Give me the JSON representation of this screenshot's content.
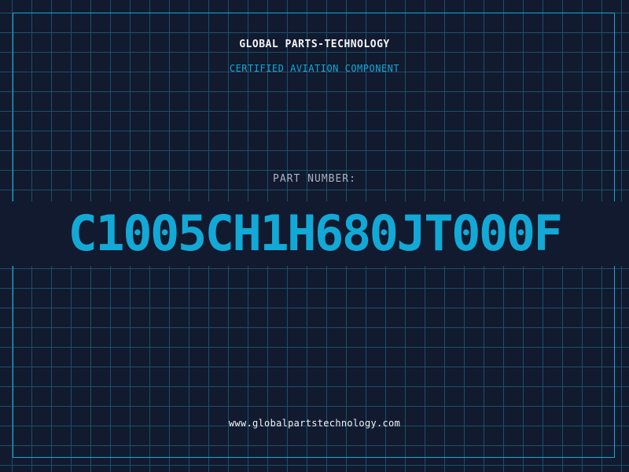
{
  "header": {
    "company_name": "GLOBAL PARTS-TECHNOLOGY",
    "subtitle": "CERTIFIED AVIATION COMPONENT"
  },
  "part": {
    "label": "PART NUMBER:",
    "number": "C1005CH1H680JT000F"
  },
  "footer": {
    "website": "www.globalpartstechnology.com"
  },
  "colors": {
    "background": "#111a2f",
    "grid_line": "#1d4f6a",
    "accent": "#12a9d6",
    "text_primary": "#f2f4f7",
    "text_muted": "#a9b3c3"
  }
}
